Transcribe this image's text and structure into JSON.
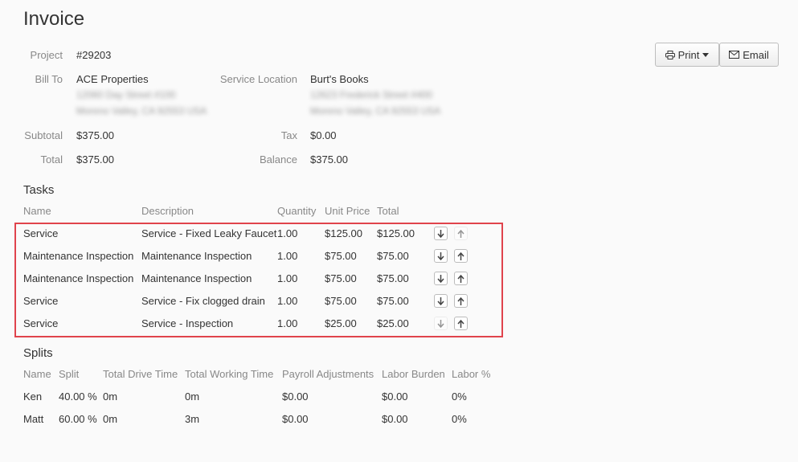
{
  "title": "Invoice",
  "toolbar": {
    "print_label": "Print",
    "email_label": "Email"
  },
  "details": {
    "project_label": "Project",
    "project_value": "#29203",
    "bill_to_label": "Bill To",
    "bill_to_name": "ACE Properties",
    "bill_to_line1": "12060 Day Street #100",
    "bill_to_line2": "Moreno Valley, CA 92553 USA",
    "service_location_label": "Service Location",
    "service_location_name": "Burt's Books",
    "service_location_line1": "12623 Frederick Street #400",
    "service_location_line2": "Moreno Valley, CA 92553 USA",
    "subtotal_label": "Subtotal",
    "subtotal_value": "$375.00",
    "tax_label": "Tax",
    "tax_value": "$0.00",
    "total_label": "Total",
    "total_value": "$375.00",
    "balance_label": "Balance",
    "balance_value": "$375.00"
  },
  "tasks": {
    "heading": "Tasks",
    "columns": [
      "Name",
      "Description",
      "Quantity",
      "Unit Price",
      "Total"
    ],
    "rows": [
      {
        "name": "Service",
        "description": "Service - Fixed Leaky Faucet",
        "quantity": "1.00",
        "unit_price": "$125.00",
        "total": "$125.00"
      },
      {
        "name": "Maintenance Inspection",
        "description": "Maintenance Inspection",
        "quantity": "1.00",
        "unit_price": "$75.00",
        "total": "$75.00"
      },
      {
        "name": "Maintenance Inspection",
        "description": "Maintenance Inspection",
        "quantity": "1.00",
        "unit_price": "$75.00",
        "total": "$75.00"
      },
      {
        "name": "Service",
        "description": "Service - Fix clogged drain",
        "quantity": "1.00",
        "unit_price": "$75.00",
        "total": "$75.00"
      },
      {
        "name": "Service",
        "description": "Service - Inspection",
        "quantity": "1.00",
        "unit_price": "$25.00",
        "total": "$25.00"
      }
    ]
  },
  "splits": {
    "heading": "Splits",
    "columns": [
      "Name",
      "Split",
      "Total Drive Time",
      "Total Working Time",
      "Payroll Adjustments",
      "Labor Burden",
      "Labor %"
    ],
    "rows": [
      {
        "name": "Ken",
        "split": "40.00 %",
        "drive": "0m",
        "working": "0m",
        "payroll": "$0.00",
        "burden": "$0.00",
        "labor_pct": "0%"
      },
      {
        "name": "Matt",
        "split": "60.00 %",
        "drive": "0m",
        "working": "3m",
        "payroll": "$0.00",
        "burden": "$0.00",
        "labor_pct": "0%"
      }
    ]
  },
  "icons": {
    "print": "printer-icon",
    "caret": "caret-down-icon",
    "email": "envelope-icon",
    "down": "arrow-down-icon",
    "up": "arrow-up-icon"
  },
  "colors": {
    "highlight": "#e0434c"
  }
}
